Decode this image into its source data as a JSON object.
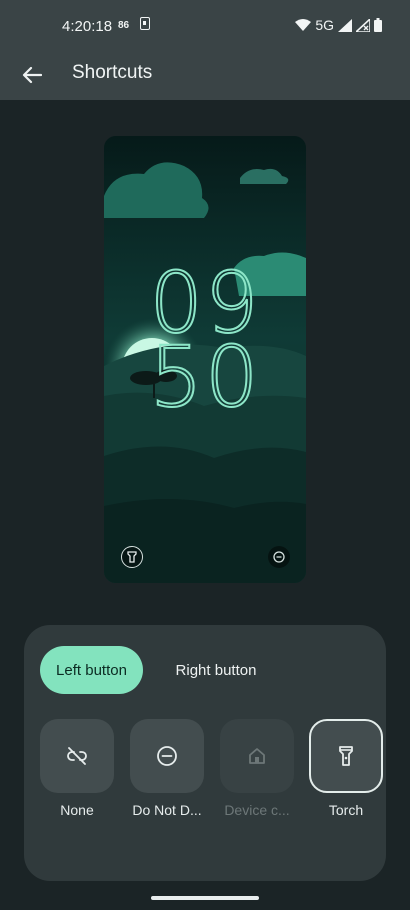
{
  "status_bar": {
    "time": "4:20:18",
    "small_badge": "86",
    "network": "5G"
  },
  "app_bar": {
    "title": "Shortcuts",
    "back_icon": "arrow-back-icon"
  },
  "preview": {
    "clock_hours": "09",
    "clock_minutes": "50",
    "left_shortcut_icon": "flashlight-icon",
    "right_shortcut_icon": "do-not-disturb-icon"
  },
  "tabs": [
    {
      "label": "Left button",
      "selected": true
    },
    {
      "label": "Right button",
      "selected": false
    }
  ],
  "options": [
    {
      "label": "None",
      "icon": "link-off-icon",
      "enabled": true,
      "selected": false
    },
    {
      "label": "Do Not D...",
      "icon": "do-not-disturb-icon",
      "enabled": true,
      "selected": false
    },
    {
      "label": "Device c...",
      "icon": "home-icon",
      "enabled": false,
      "selected": false
    },
    {
      "label": "Torch",
      "icon": "flashlight-icon",
      "enabled": true,
      "selected": true
    }
  ],
  "colors": {
    "accent": "#83e3be",
    "panel": "#303a3c",
    "background": "#1b2426",
    "app_bar": "#3a4446"
  }
}
